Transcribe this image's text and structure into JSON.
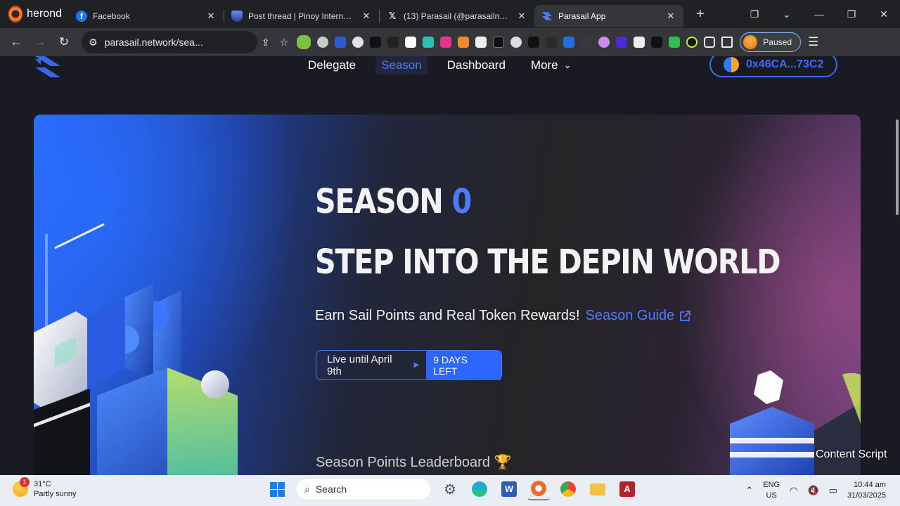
{
  "browser": {
    "name": "herond",
    "tabs": [
      {
        "title": "Facebook",
        "icon": "facebook-icon",
        "active": false
      },
      {
        "title": "Post thread | Pinoy Internet and",
        "icon": "forum-shield-icon",
        "active": false
      },
      {
        "title": "(13) Parasail (@parasailnetwork",
        "icon": "x-icon",
        "active": false
      },
      {
        "title": "Parasail App",
        "icon": "parasail-icon",
        "active": true
      }
    ],
    "url": "parasail.network/sea...",
    "profile_status": "Paused"
  },
  "site": {
    "nav": [
      {
        "label": "Delegate",
        "active": false
      },
      {
        "label": "Season",
        "active": true
      },
      {
        "label": "Dashboard",
        "active": false
      },
      {
        "label": "More",
        "active": false
      }
    ],
    "wallet": "0x46CA...73C2"
  },
  "hero": {
    "title_prefix": "SEASON",
    "title_number": "0",
    "subtitle": "STEP INTO THE DEPIN WORLD",
    "description": "Earn Sail Points and Real Token Rewards!",
    "guide_link": "Season Guide",
    "live_text": "Live until April 9th",
    "days_left": "9 DAYS LEFT",
    "leaderboard_title": "Season Points Leaderboard 🏆"
  },
  "overlay": {
    "content_script": "Content Script"
  },
  "taskbar": {
    "weather_temp": "31°C",
    "weather_desc": "Partly sunny",
    "weather_badge": "1",
    "search_placeholder": "Search",
    "lang_top": "ENG",
    "lang_bottom": "US",
    "time": "10:44 am",
    "date": "31/03/2025"
  },
  "colors": {
    "accent": "#4d7bff",
    "page_bg": "#1a1b22",
    "browser_bg": "#202124"
  }
}
